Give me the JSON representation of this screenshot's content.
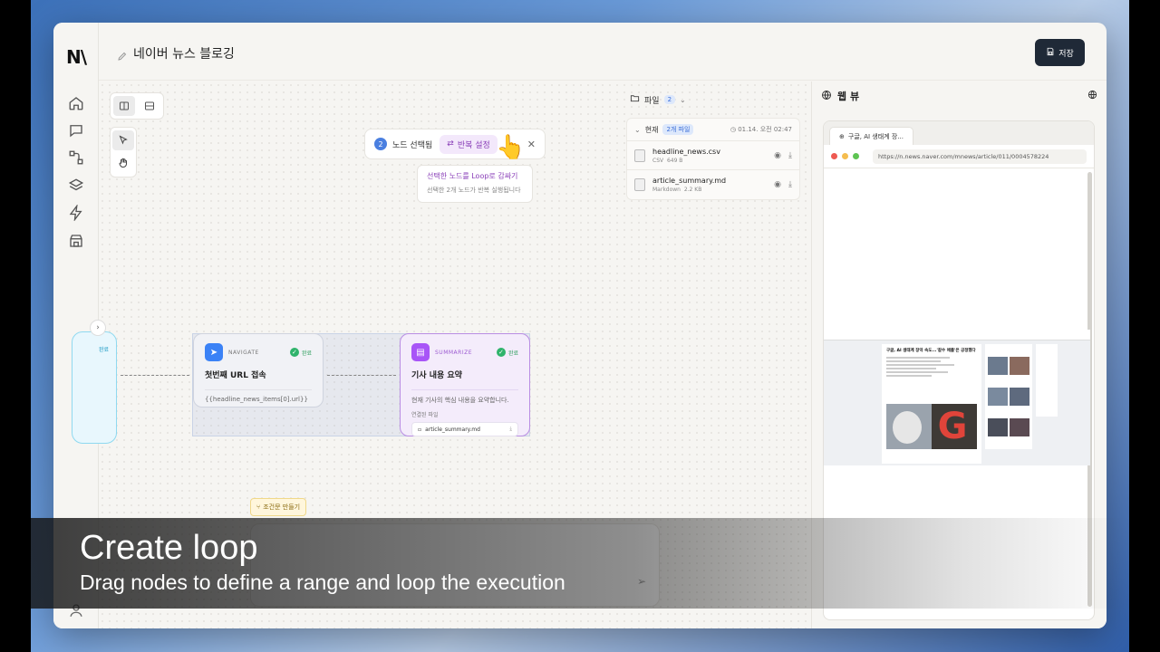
{
  "app": {
    "logo": "N\\",
    "title": "네이버 뉴스 블로깅",
    "save_label": "저장"
  },
  "sidebar": {
    "items": [
      {
        "icon": "home-icon"
      },
      {
        "icon": "chat-icon"
      },
      {
        "icon": "workflow-icon"
      },
      {
        "icon": "layers-icon"
      },
      {
        "icon": "bolt-icon"
      },
      {
        "icon": "store-icon"
      }
    ]
  },
  "selection": {
    "count": "2",
    "label": "노드 선택됨",
    "loop_button": "반복 설정",
    "tooltip_title": "선택한 노드를 Loop로 감싸기",
    "tooltip_desc": "선택한 2개 노드가 반복 실행됩니다"
  },
  "files": {
    "header_label": "파일",
    "header_count": "2",
    "current_label": "현재",
    "current_count": "2개 파일",
    "timestamp": "01.14. 오전 02:47",
    "items": [
      {
        "name": "headline_news.csv",
        "type": "CSV",
        "size": "649 B"
      },
      {
        "name": "article_summary.md",
        "type": "Markdown",
        "size": "2.2 KB"
      }
    ]
  },
  "nodes": {
    "left_status": "완료",
    "navigate": {
      "type": "NAVIGATE",
      "status": "완료",
      "title": "첫번째 URL 접속",
      "desc": "{{headline_news_items[0].url}}"
    },
    "summarize": {
      "type": "SUMMARIZE",
      "status": "완료",
      "title": "기사 내용 요약",
      "desc": "현재 기사의 핵심 내용을 요약합니다.",
      "linked_label": "연결된 파일",
      "linked_file": "article_summary.md"
    }
  },
  "condition_button": "조건문 만들기",
  "webview": {
    "title": "웹 뷰",
    "tab_title": "구글, AI 생태계 장...",
    "url": "https://n.news.naver.com/mnews/article/011/0004578224",
    "page_headline": "구글, AI 생태계 장악 속도...'갈수 애플'은 긍정했다"
  },
  "caption": {
    "title": "Create loop",
    "subtitle": "Drag nodes to define a range and loop the execution"
  },
  "colors": {
    "accent_blue": "#4a7fe0",
    "accent_purple": "#8a3fb8",
    "success_green": "#2fb36b",
    "save_button": "#1f2937"
  }
}
